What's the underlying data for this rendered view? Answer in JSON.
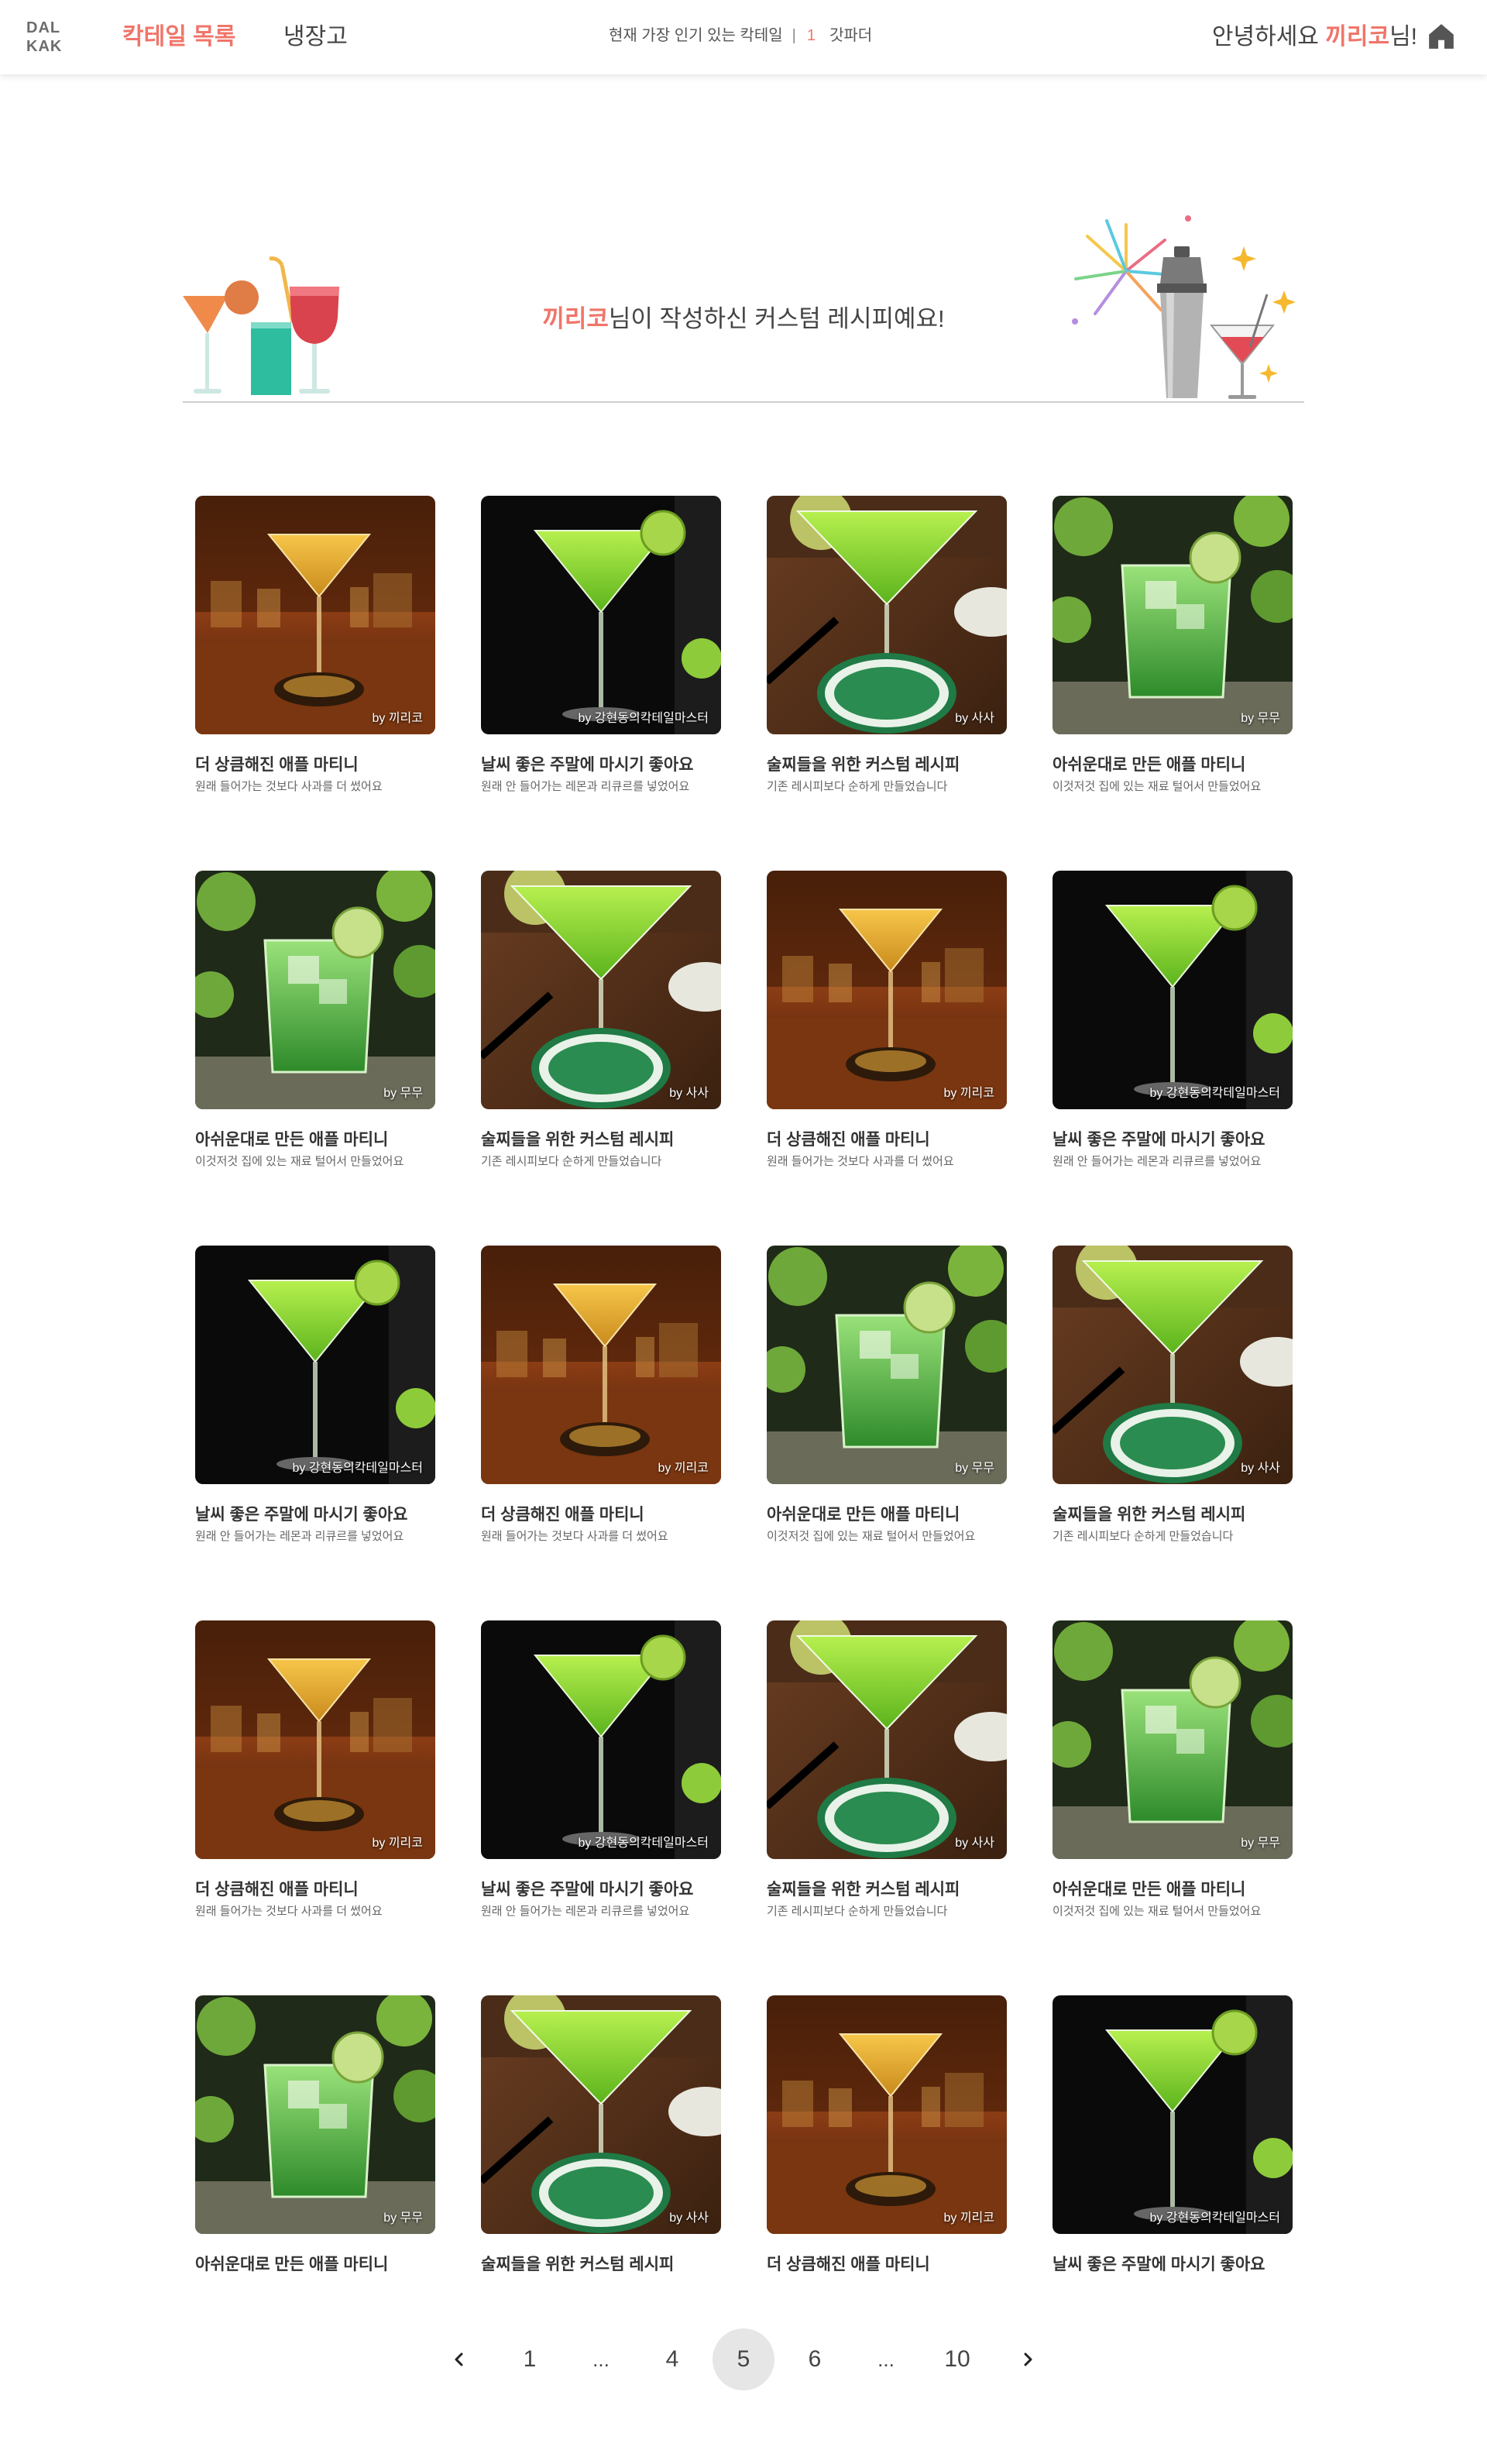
{
  "header": {
    "logo_line1": "DAL",
    "logo_line2": "KAK",
    "nav_cocktails": "칵테일 목록",
    "nav_fridge": "냉장고",
    "popular_label": "현재 가장 인기 있는 칵테일",
    "popular_sep": "|",
    "popular_rank": "1",
    "popular_name": "갓파더",
    "greeting_prefix": "안녕하세요 ",
    "greeting_name": "끼리코",
    "greeting_suffix": "님!",
    "home_icon": "home-icon"
  },
  "banner": {
    "user": "끼리코",
    "text": "님이 작성하신 커스텀 레시피예요!",
    "left_icon": "cocktail-glasses-icon",
    "right_icon": "shaker-fireworks-icon"
  },
  "cards": [
    {
      "image": "amber-martini",
      "by": "by 끼리코",
      "title": "더 상큼해진 애플 마티니",
      "desc": "원래 들어가는 것보다 사과를 더 썼어요"
    },
    {
      "image": "green-martini-dark",
      "by": "by 강현동의칵테일마스터",
      "title": "날씨 좋은 주말에 마시기 좋아요",
      "desc": "원래 안 들어가는 레몬과 리큐르를 넣었어요"
    },
    {
      "image": "green-martini-coaster",
      "by": "by 사사",
      "title": "술찌들을 위한 커스텀 레시피",
      "desc": "기존 레시피보다 순하게 만들었습니다"
    },
    {
      "image": "green-apple-rocks",
      "by": "by 무무",
      "title": "아쉬운대로 만든 애플 마티니",
      "desc": "이것저것 집에 있는 재료 털어서 만들었어요"
    },
    {
      "image": "green-apple-rocks",
      "by": "by 무무",
      "title": "아쉬운대로 만든 애플 마티니",
      "desc": "이것저것 집에 있는 재료 털어서 만들었어요"
    },
    {
      "image": "green-martini-coaster",
      "by": "by 사사",
      "title": "술찌들을 위한 커스텀 레시피",
      "desc": "기존 레시피보다 순하게 만들었습니다"
    },
    {
      "image": "amber-martini",
      "by": "by 끼리코",
      "title": "더 상큼해진 애플 마티니",
      "desc": "원래 들어가는 것보다 사과를 더 썼어요"
    },
    {
      "image": "green-martini-dark",
      "by": "by 강현동의칵테일마스터",
      "title": "날씨 좋은 주말에 마시기 좋아요",
      "desc": "원래 안 들어가는 레몬과 리큐르를 넣었어요"
    },
    {
      "image": "green-martini-dark",
      "by": "by 강현동의칵테일마스터",
      "title": "날씨 좋은 주말에 마시기 좋아요",
      "desc": "원래 안 들어가는 레몬과 리큐르를 넣었어요"
    },
    {
      "image": "amber-martini",
      "by": "by 끼리코",
      "title": "더 상큼해진 애플 마티니",
      "desc": "원래 들어가는 것보다 사과를 더 썼어요"
    },
    {
      "image": "green-apple-rocks",
      "by": "by 무무",
      "title": "아쉬운대로 만든 애플 마티니",
      "desc": "이것저것 집에 있는 재료 털어서 만들었어요"
    },
    {
      "image": "green-martini-coaster",
      "by": "by 사사",
      "title": "술찌들을 위한 커스텀 레시피",
      "desc": "기존 레시피보다 순하게 만들었습니다"
    },
    {
      "image": "amber-martini",
      "by": "by 끼리코",
      "title": "더 상큼해진 애플 마티니",
      "desc": "원래 들어가는 것보다 사과를 더 썼어요"
    },
    {
      "image": "green-martini-dark",
      "by": "by 강현동의칵테일마스터",
      "title": "날씨 좋은 주말에 마시기 좋아요",
      "desc": "원래 안 들어가는 레몬과 리큐르를 넣었어요"
    },
    {
      "image": "green-martini-coaster",
      "by": "by 사사",
      "title": "술찌들을 위한 커스텀 레시피",
      "desc": "기존 레시피보다 순하게 만들었습니다"
    },
    {
      "image": "green-apple-rocks",
      "by": "by 무무",
      "title": "아쉬운대로 만든 애플 마티니",
      "desc": "이것저것 집에 있는 재료 털어서 만들었어요"
    },
    {
      "image": "green-apple-rocks",
      "by": "by 무무",
      "title": "아쉬운대로 만든 애플 마티니",
      "desc": ""
    },
    {
      "image": "green-martini-coaster",
      "by": "by 사사",
      "title": "술찌들을 위한 커스텀 레시피",
      "desc": ""
    },
    {
      "image": "amber-martini",
      "by": "by 끼리코",
      "title": "더 상큼해진 애플 마티니",
      "desc": ""
    },
    {
      "image": "green-martini-dark",
      "by": "by 강현동의칵테일마스터",
      "title": "날씨 좋은 주말에 마시기 좋아요",
      "desc": ""
    }
  ],
  "pagination": {
    "prev_icon": "chevron-left-icon",
    "next_icon": "chevron-right-icon",
    "items": [
      "1",
      "...",
      "4",
      "5",
      "6",
      "...",
      "10"
    ],
    "active": "5"
  }
}
